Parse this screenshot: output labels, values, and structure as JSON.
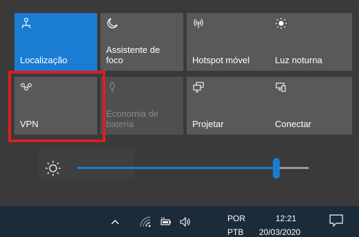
{
  "tiles": {
    "location": "Localização",
    "focus_assist": "Assistente de foco",
    "mobile_hotspot": "Hotspot móvel",
    "night_light": "Luz noturna",
    "vpn": "VPN",
    "battery_saver": "Economia de bateria",
    "project": "Projetar",
    "connect": "Conectar"
  },
  "brightness": {
    "level_percent": 86
  },
  "taskbar": {
    "language_top": "POR",
    "language_bottom": "PTB",
    "time": "12:21",
    "date": "20/03/2020"
  },
  "colors": {
    "accent": "#1a7cd3",
    "highlight": "#e01c24"
  }
}
